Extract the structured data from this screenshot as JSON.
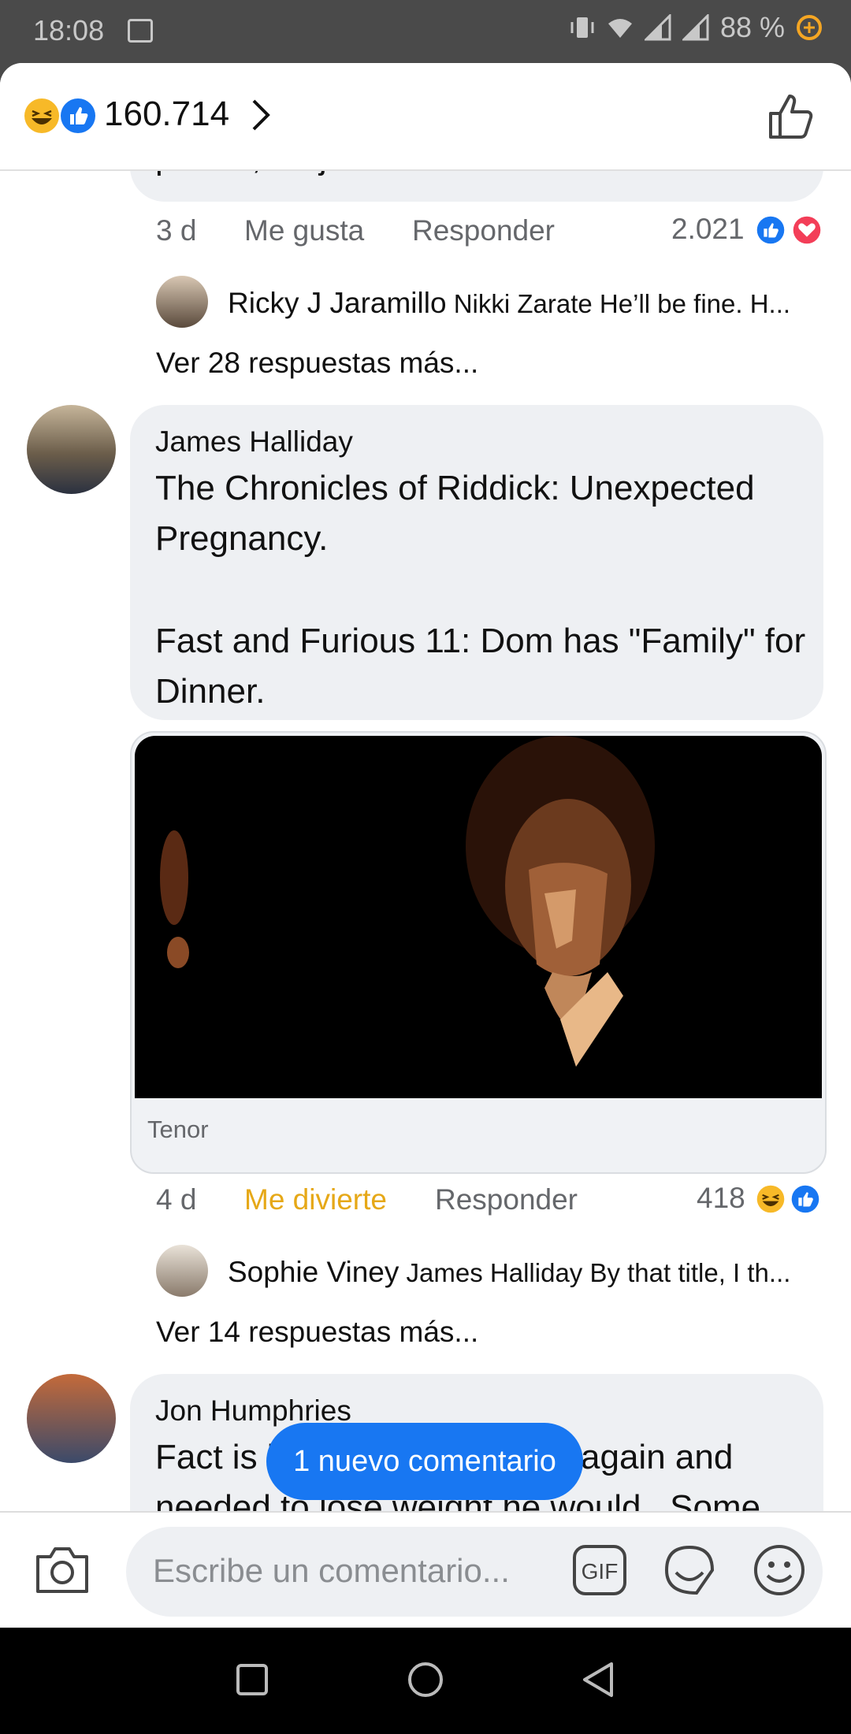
{
  "status": {
    "time": "18:08",
    "battery": "88 %"
  },
  "header": {
    "reaction_count": "160.714"
  },
  "comments": {
    "prev_tail_text": "pound, he just wants to relax!",
    "prev_meta": {
      "age": "3 d",
      "like": "Me gusta",
      "reply": "Responder",
      "count": "2.021"
    },
    "prev_reply": {
      "name": "Ricky J Jaramillo",
      "snippet": "Nikki Zarate He’ll be fine. H..."
    },
    "prev_more": "Ver 28 respuestas más...",
    "c1": {
      "name": "James Halliday",
      "line1": "The Chronicles of Riddick: Unexpected",
      "line2": "Pregnancy.",
      "line3": "Fast and Furious 11: Dom has \"Family\" for",
      "line4": "Dinner.",
      "gif_source": "Tenor",
      "age": "4 d",
      "reaction_label": "Me divierte",
      "reply": "Responder",
      "count": "418",
      "reply_preview": {
        "name": "Sophie Viney",
        "snippet": "James Halliday By that title, I th..."
      },
      "more": "Ver 14 respuestas más..."
    },
    "c2": {
      "name": "Jon Humphries",
      "line1a": "Fact is i",
      "line1b": "again and",
      "line2": "needed to lose weight he would . Some"
    }
  },
  "new_comment_pill": "1 nuevo comentario",
  "composer": {
    "placeholder": "Escribe un comentario..."
  },
  "colors": {
    "accent_blue": "#1877f2",
    "haha_yellow": "#f7b928",
    "heart_red": "#f33e58",
    "reaction_label_color": "#e6a817"
  },
  "icons": [
    "gallery-icon",
    "vibrate-icon",
    "wifi-icon",
    "signal-icon",
    "battery-icon",
    "haha-icon",
    "like-icon",
    "chevron-right-icon",
    "like-outline-icon",
    "heart-icon",
    "camera-icon",
    "gif-icon",
    "sticker-icon",
    "emoji-icon",
    "nav-back-icon",
    "nav-home-icon",
    "nav-recents-icon"
  ]
}
